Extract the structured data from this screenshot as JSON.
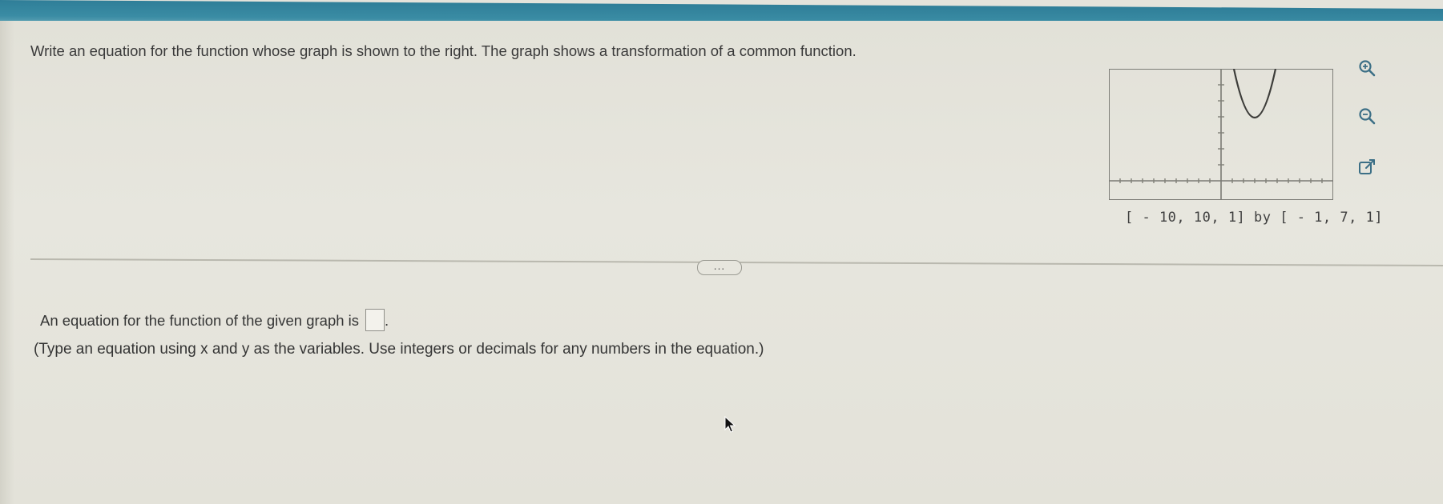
{
  "question": {
    "prompt": "Write an equation for the function whose graph is shown to the right. The graph shows a transformation of a common function."
  },
  "graph": {
    "window_caption": "[ - 10, 10, 1] by [ - 1, 7, 1]",
    "x_window": [
      -10,
      10
    ],
    "x_scale": 1,
    "y_window": [
      -1,
      7
    ],
    "y_scale": 1,
    "curve_shape": "upward parabola",
    "icons": {
      "zoom_in": "zoom-in-icon",
      "zoom_out": "zoom-out-icon",
      "popout": "popout-icon"
    }
  },
  "more_button_label": "...",
  "answer": {
    "prefix": "An equation for the function of the given graph is",
    "suffix": ".",
    "value": ""
  },
  "hint": "(Type an equation using x and y as the variables. Use integers or decimals for any numbers in the equation.)",
  "colors": {
    "header_bar": "#3a8ca4",
    "page_background": "#e4e3db",
    "text": "#353535"
  }
}
